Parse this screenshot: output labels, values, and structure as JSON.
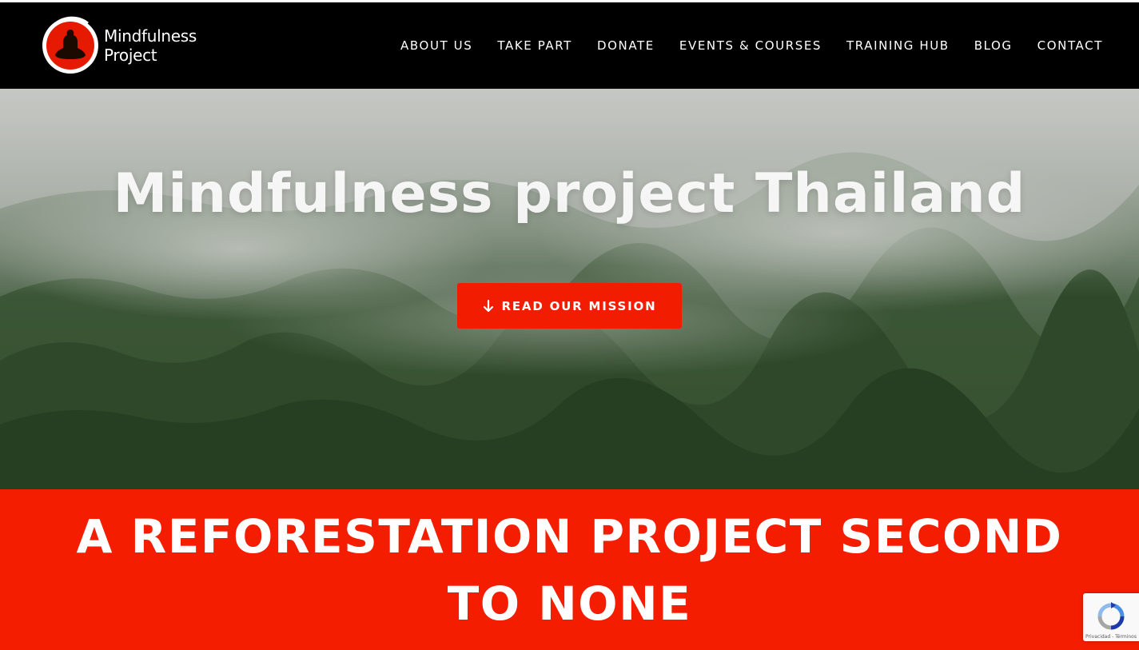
{
  "brand": {
    "name_line1": "Mindfulness",
    "name_line2": "Project"
  },
  "nav": {
    "items": [
      {
        "label": "ABOUT US"
      },
      {
        "label": "TAKE PART"
      },
      {
        "label": "DONATE"
      },
      {
        "label": "EVENTS & COURSES"
      },
      {
        "label": "TRAINING HUB"
      },
      {
        "label": "BLOG"
      },
      {
        "label": "CONTACT"
      }
    ]
  },
  "hero": {
    "title": "Mindfulness project Thailand",
    "button_label": "READ OUR MISSION",
    "button_icon": "arrow-down-icon"
  },
  "banner": {
    "text": "A REFORESTATION PROJECT SECOND TO NONE"
  },
  "recaptcha": {
    "links": "Privacidad - Términos"
  },
  "colors": {
    "header_bg": "#000000",
    "accent_red": "#f21c00",
    "banner_red": "#f41d00",
    "text_white": "#ffffff"
  }
}
